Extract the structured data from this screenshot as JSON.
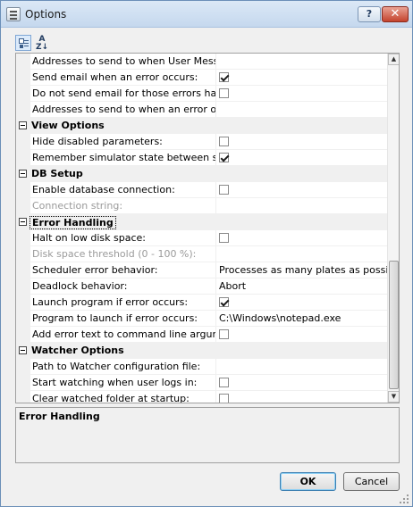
{
  "window": {
    "title": "Options",
    "help_label": "?",
    "close_label": "✕"
  },
  "toolbar": {
    "alpha_label": "A\nZ↓",
    "cat_icon": "categorized-icon",
    "alpha_icon": "sort-alphabetical-icon"
  },
  "grid": {
    "rows": [
      {
        "kind": "prop",
        "name": "Addresses to send to when User Message task",
        "value": ""
      },
      {
        "kind": "prop",
        "name": "Send email when an error occurs:",
        "check": true
      },
      {
        "kind": "prop",
        "name": "Do not send email for those errors handled by",
        "check": false
      },
      {
        "kind": "prop",
        "name": "Addresses to send to when an error occurs:",
        "value": ""
      },
      {
        "kind": "cat",
        "name": "View Options"
      },
      {
        "kind": "prop",
        "name": "Hide disabled parameters:",
        "check": false
      },
      {
        "kind": "prop",
        "name": "Remember simulator state between sessions:",
        "check": true
      },
      {
        "kind": "cat",
        "name": "DB Setup"
      },
      {
        "kind": "prop",
        "name": "Enable database connection:",
        "check": false
      },
      {
        "kind": "prop",
        "name": "Connection string:",
        "value": "",
        "disabled": true
      },
      {
        "kind": "cat",
        "name": "Error Handling",
        "selected": true
      },
      {
        "kind": "prop",
        "name": "Halt on low disk space:",
        "check": false
      },
      {
        "kind": "prop",
        "name": "Disk space threshold (0 - 100 %):",
        "value": "",
        "disabled": true
      },
      {
        "kind": "prop",
        "name": "Scheduler error behavior:",
        "value": "Processes as many plates as possible"
      },
      {
        "kind": "prop",
        "name": "Deadlock behavior:",
        "value": "Abort"
      },
      {
        "kind": "prop",
        "name": "Launch program if error occurs:",
        "check": true
      },
      {
        "kind": "prop",
        "name": "Program to launch if error occurs:",
        "value": "C:\\Windows\\notepad.exe"
      },
      {
        "kind": "prop",
        "name": "Add error text to command line argument:",
        "check": false
      },
      {
        "kind": "cat",
        "name": "Watcher Options"
      },
      {
        "kind": "prop",
        "name": "Path to Watcher configuration file:",
        "value": ""
      },
      {
        "kind": "prop",
        "name": "Start watching when user logs in:",
        "check": false
      },
      {
        "kind": "prop",
        "name": "Clear watched folder at startup:",
        "check": false
      }
    ]
  },
  "description": {
    "title": "Error Handling"
  },
  "buttons": {
    "ok": "OK",
    "cancel": "Cancel"
  }
}
